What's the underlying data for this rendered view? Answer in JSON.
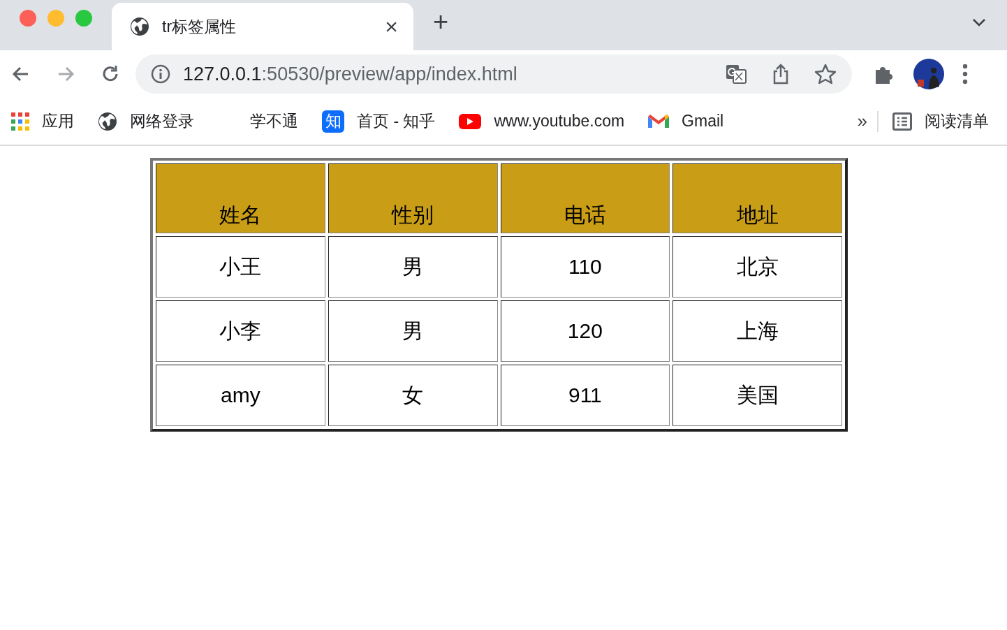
{
  "tabs": [
    {
      "title": "tr标签属性",
      "selected": true,
      "close": "×"
    }
  ],
  "new_tab": "+",
  "toolbar": {
    "nav": [
      {
        "kind": "back",
        "disabled": false
      },
      {
        "kind": "forward",
        "disabled": true
      },
      {
        "kind": "reload",
        "disabled": false
      }
    ],
    "url": {
      "host": "127.0.0.1",
      "path": ":50530/preview/app/index.html"
    }
  },
  "bookmarks": [
    {
      "kind": "apps",
      "label": "应用"
    },
    {
      "kind": "globe",
      "label": "网络登录"
    },
    {
      "kind": "blank",
      "label": "学不通"
    },
    {
      "kind": "zhihu",
      "label": "首页 - 知乎",
      "icon_text": "知"
    },
    {
      "kind": "youtube",
      "label": "www.youtube.com"
    },
    {
      "kind": "gmail",
      "label": "Gmail"
    }
  ],
  "bookmarks_overflow": "»",
  "reading_list": "阅读清单",
  "table": {
    "columns": [
      "姓名",
      "性别",
      "电话",
      "地址"
    ],
    "rows": [
      [
        "小王",
        "男",
        "110",
        "北京"
      ],
      [
        "小李",
        "男",
        "120",
        "上海"
      ],
      [
        "amy",
        "女",
        "911",
        "美国"
      ]
    ]
  }
}
